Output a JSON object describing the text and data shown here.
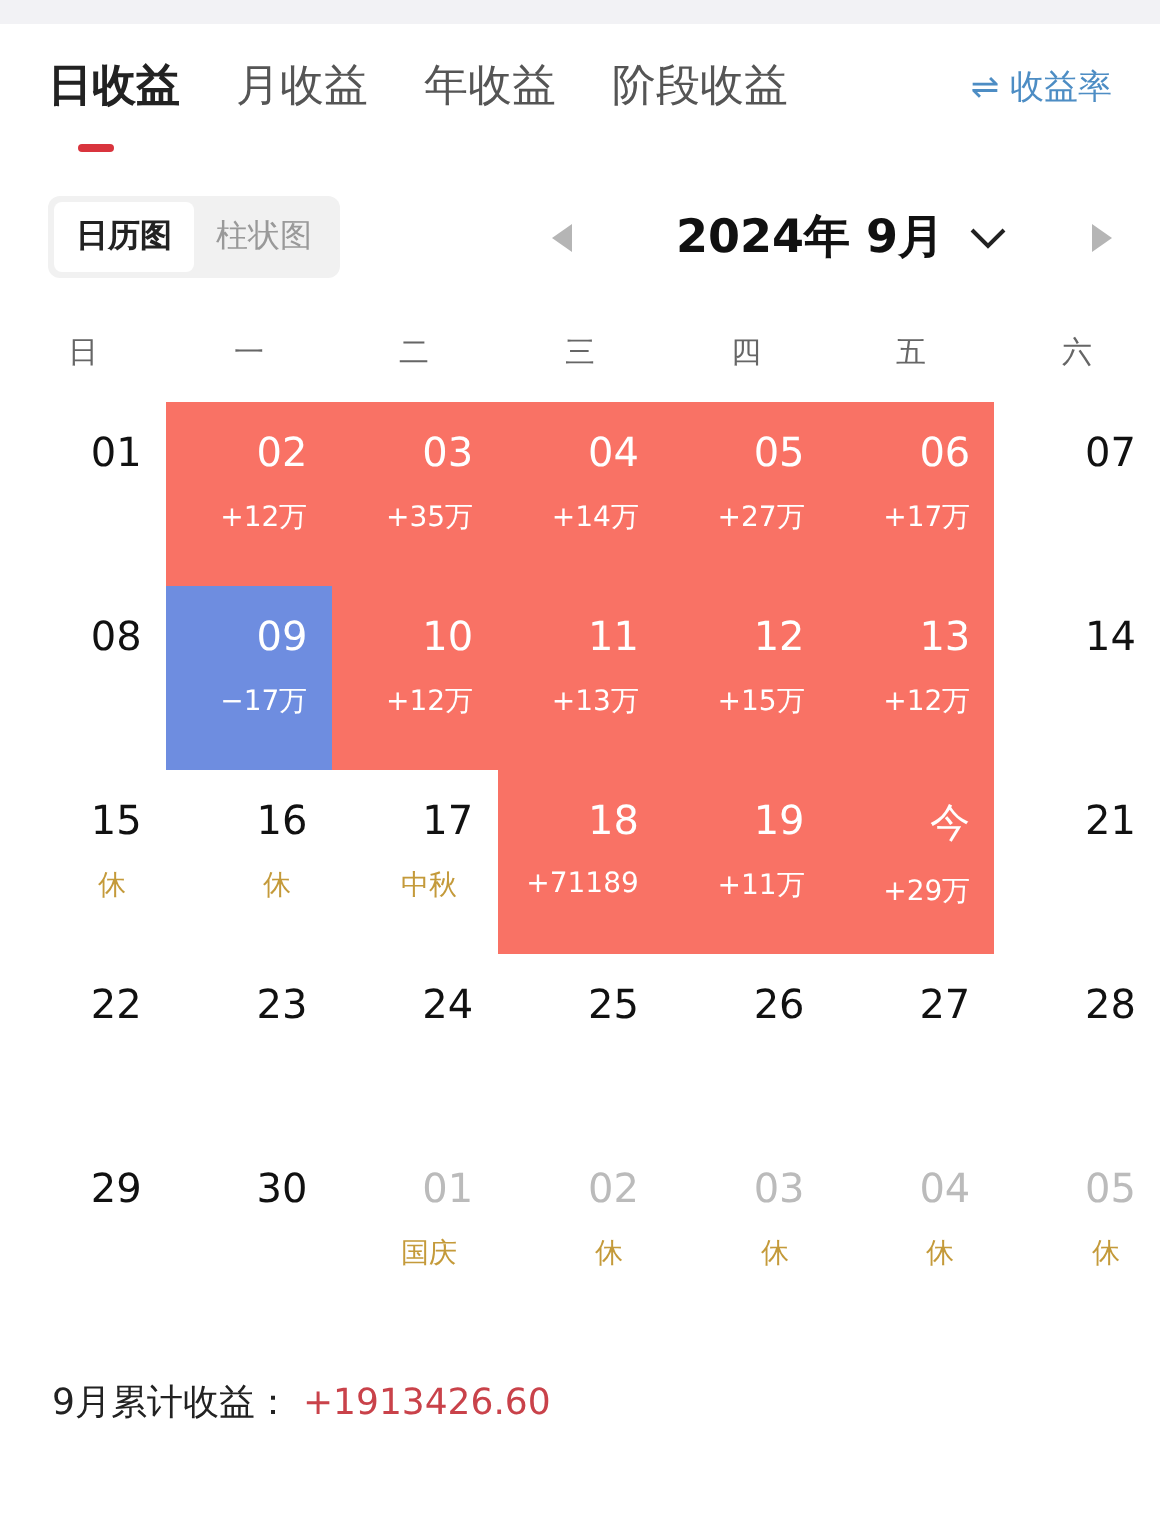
{
  "tabs": [
    {
      "label": "日收益",
      "selected": true
    },
    {
      "label": "月收益",
      "selected": false
    },
    {
      "label": "年收益",
      "selected": false
    },
    {
      "label": "阶段收益",
      "selected": false
    }
  ],
  "rate_toggle": {
    "icon": "⇌",
    "label": "收益率"
  },
  "view_switch": [
    {
      "label": "日历图",
      "selected": true
    },
    {
      "label": "柱状图",
      "selected": false
    }
  ],
  "month": {
    "label": "2024年 9月"
  },
  "weekdays": [
    "日",
    "一",
    "二",
    "三",
    "四",
    "五",
    "六"
  ],
  "weeks": [
    {
      "days": [
        {
          "day": "01",
          "in_month": true
        },
        {
          "day": "02",
          "in_month": true,
          "profit": "+12万",
          "color": "#f97265"
        },
        {
          "day": "03",
          "in_month": true,
          "profit": "+35万",
          "color": "#f97265"
        },
        {
          "day": "04",
          "in_month": true,
          "profit": "+14万",
          "color": "#f97265"
        },
        {
          "day": "05",
          "in_month": true,
          "profit": "+27万",
          "color": "#f97265"
        },
        {
          "day": "06",
          "in_month": true,
          "profit": "+17万",
          "color": "#f97265"
        },
        {
          "day": "07",
          "in_month": true
        }
      ]
    },
    {
      "days": [
        {
          "day": "08",
          "in_month": true
        },
        {
          "day": "09",
          "in_month": true,
          "profit": "−17万",
          "color": "#6e8de0"
        },
        {
          "day": "10",
          "in_month": true,
          "profit": "+12万",
          "color": "#f97265"
        },
        {
          "day": "11",
          "in_month": true,
          "profit": "+13万",
          "color": "#f97265"
        },
        {
          "day": "12",
          "in_month": true,
          "profit": "+15万",
          "color": "#f97265"
        },
        {
          "day": "13",
          "in_month": true,
          "profit": "+12万",
          "color": "#f97265"
        },
        {
          "day": "14",
          "in_month": true
        }
      ]
    },
    {
      "days": [
        {
          "day": "15",
          "in_month": true,
          "holiday": "休"
        },
        {
          "day": "16",
          "in_month": true,
          "holiday": "休"
        },
        {
          "day": "17",
          "in_month": true,
          "holiday": "中秋"
        },
        {
          "day": "18",
          "in_month": true,
          "profit": "+71189",
          "color": "#f97265"
        },
        {
          "day": "19",
          "in_month": true,
          "profit": "+11万",
          "color": "#f97265"
        },
        {
          "day": "今",
          "in_month": true,
          "profit": "+29万",
          "color": "#f97265"
        },
        {
          "day": "21",
          "in_month": true
        }
      ]
    },
    {
      "days": [
        {
          "day": "22",
          "in_month": true
        },
        {
          "day": "23",
          "in_month": true
        },
        {
          "day": "24",
          "in_month": true
        },
        {
          "day": "25",
          "in_month": true
        },
        {
          "day": "26",
          "in_month": true
        },
        {
          "day": "27",
          "in_month": true
        },
        {
          "day": "28",
          "in_month": true
        }
      ]
    },
    {
      "days": [
        {
          "day": "29",
          "in_month": true
        },
        {
          "day": "30",
          "in_month": true
        },
        {
          "day": "01",
          "in_month": false,
          "holiday": "国庆"
        },
        {
          "day": "02",
          "in_month": false,
          "holiday": "休"
        },
        {
          "day": "03",
          "in_month": false,
          "holiday": "休"
        },
        {
          "day": "04",
          "in_month": false,
          "holiday": "休"
        },
        {
          "day": "05",
          "in_month": false,
          "holiday": "休"
        }
      ]
    }
  ],
  "summary": {
    "label": "9月累计收益：",
    "value": "+1913426.60"
  }
}
